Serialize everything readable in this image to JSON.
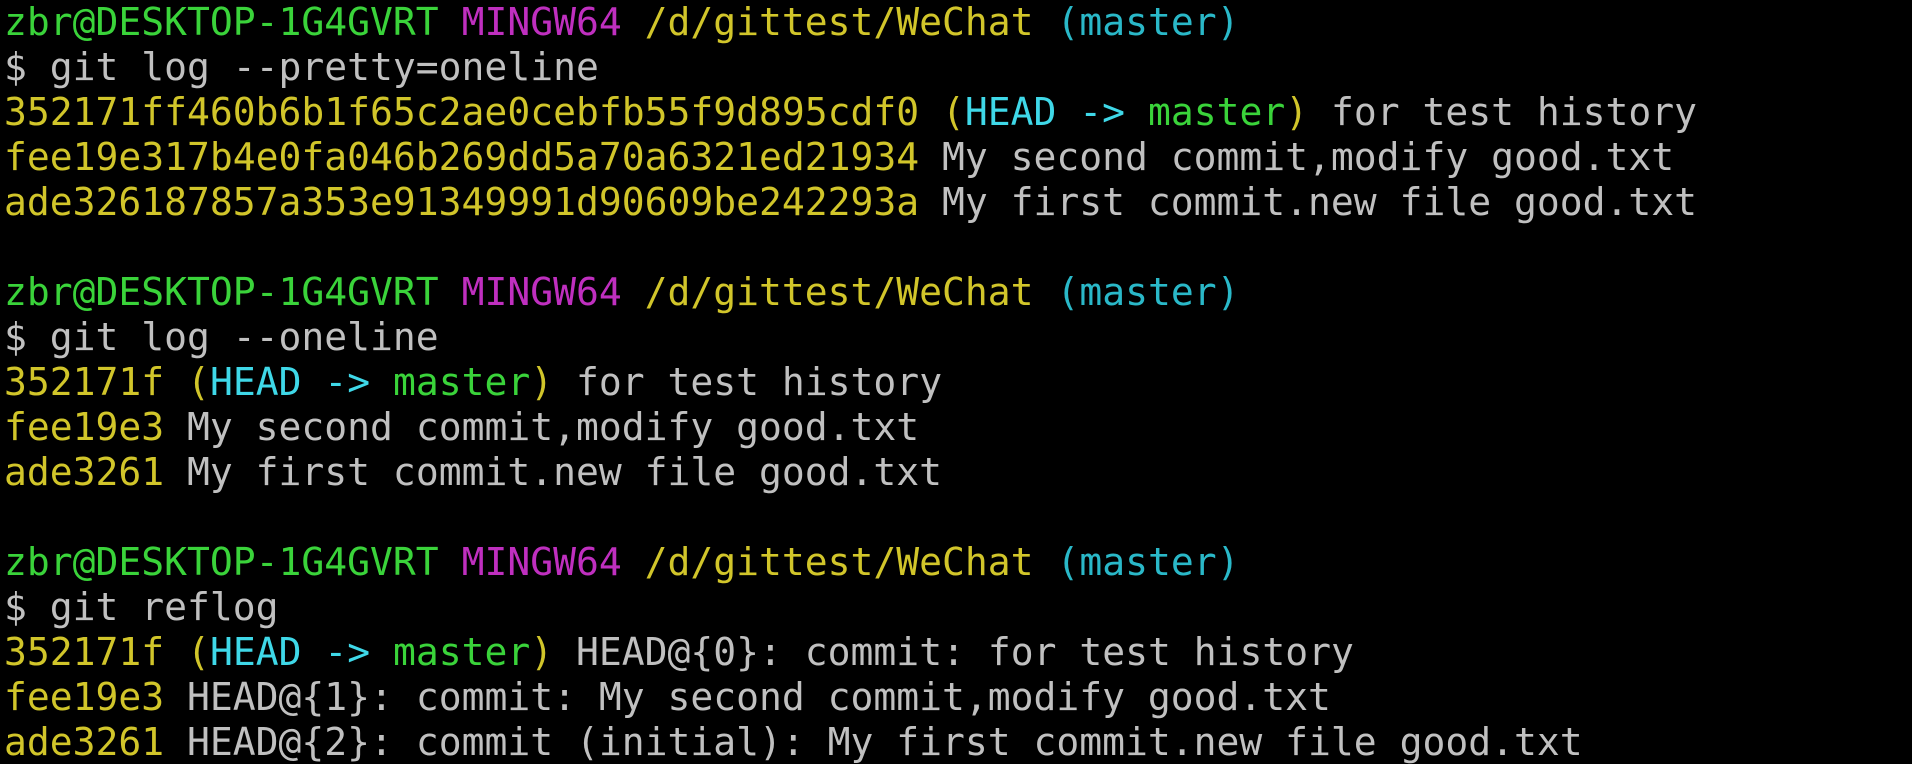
{
  "colors": {
    "background": "#000000",
    "text": "#c0c0c0",
    "prompt_user": "#3ad33a",
    "prompt_system": "#bf2fbf",
    "prompt_path": "#d1c52a",
    "prompt_branch": "#2ab8c8",
    "hash": "#d1c52a",
    "paren": "#d1c52a",
    "head": "#3fd8e8",
    "branch": "#3ad33a"
  },
  "lines": [
    {
      "kind": "prompt",
      "segments": [
        {
          "text": "zbr@DESKTOP-1G4GVRT",
          "color": "prompt_user"
        },
        {
          "text": " ",
          "color": "text"
        },
        {
          "text": "MINGW64",
          "color": "prompt_system"
        },
        {
          "text": " ",
          "color": "text"
        },
        {
          "text": "/d/gittest/WeChat",
          "color": "prompt_path"
        },
        {
          "text": " ",
          "color": "text"
        },
        {
          "text": "(master)",
          "color": "prompt_branch"
        }
      ]
    },
    {
      "kind": "command",
      "segments": [
        {
          "text": "$ git log --pretty=oneline",
          "color": "text"
        }
      ]
    },
    {
      "kind": "output",
      "segments": [
        {
          "text": "352171ff460b6b1f65c2ae0cebfb55f9d895cdf0",
          "color": "hash"
        },
        {
          "text": " ",
          "color": "text"
        },
        {
          "text": "(",
          "color": "paren"
        },
        {
          "text": "HEAD -> ",
          "color": "head"
        },
        {
          "text": "master",
          "color": "branch"
        },
        {
          "text": ")",
          "color": "paren"
        },
        {
          "text": " for test history",
          "color": "text"
        }
      ]
    },
    {
      "kind": "output",
      "segments": [
        {
          "text": "fee19e317b4e0fa046b269dd5a70a6321ed21934",
          "color": "hash"
        },
        {
          "text": " My second commit,modify good.txt",
          "color": "text"
        }
      ]
    },
    {
      "kind": "output",
      "segments": [
        {
          "text": "ade326187857a353e91349991d90609be242293a",
          "color": "hash"
        },
        {
          "text": " My first commit.new file good.txt",
          "color": "text"
        }
      ]
    },
    {
      "kind": "blank",
      "segments": []
    },
    {
      "kind": "prompt",
      "segments": [
        {
          "text": "zbr@DESKTOP-1G4GVRT",
          "color": "prompt_user"
        },
        {
          "text": " ",
          "color": "text"
        },
        {
          "text": "MINGW64",
          "color": "prompt_system"
        },
        {
          "text": " ",
          "color": "text"
        },
        {
          "text": "/d/gittest/WeChat",
          "color": "prompt_path"
        },
        {
          "text": " ",
          "color": "text"
        },
        {
          "text": "(master)",
          "color": "prompt_branch"
        }
      ]
    },
    {
      "kind": "command",
      "segments": [
        {
          "text": "$ git log --oneline",
          "color": "text"
        }
      ]
    },
    {
      "kind": "output",
      "segments": [
        {
          "text": "352171f",
          "color": "hash"
        },
        {
          "text": " ",
          "color": "text"
        },
        {
          "text": "(",
          "color": "paren"
        },
        {
          "text": "HEAD -> ",
          "color": "head"
        },
        {
          "text": "master",
          "color": "branch"
        },
        {
          "text": ")",
          "color": "paren"
        },
        {
          "text": " for test history",
          "color": "text"
        }
      ]
    },
    {
      "kind": "output",
      "segments": [
        {
          "text": "fee19e3",
          "color": "hash"
        },
        {
          "text": " My second commit,modify good.txt",
          "color": "text"
        }
      ]
    },
    {
      "kind": "output",
      "segments": [
        {
          "text": "ade3261",
          "color": "hash"
        },
        {
          "text": " My first commit.new file good.txt",
          "color": "text"
        }
      ]
    },
    {
      "kind": "blank",
      "segments": []
    },
    {
      "kind": "prompt",
      "segments": [
        {
          "text": "zbr@DESKTOP-1G4GVRT",
          "color": "prompt_user"
        },
        {
          "text": " ",
          "color": "text"
        },
        {
          "text": "MINGW64",
          "color": "prompt_system"
        },
        {
          "text": " ",
          "color": "text"
        },
        {
          "text": "/d/gittest/WeChat",
          "color": "prompt_path"
        },
        {
          "text": " ",
          "color": "text"
        },
        {
          "text": "(master)",
          "color": "prompt_branch"
        }
      ]
    },
    {
      "kind": "command",
      "segments": [
        {
          "text": "$ git reflog",
          "color": "text"
        }
      ]
    },
    {
      "kind": "output",
      "segments": [
        {
          "text": "352171f",
          "color": "hash"
        },
        {
          "text": " ",
          "color": "text"
        },
        {
          "text": "(",
          "color": "paren"
        },
        {
          "text": "HEAD -> ",
          "color": "head"
        },
        {
          "text": "master",
          "color": "branch"
        },
        {
          "text": ")",
          "color": "paren"
        },
        {
          "text": " HEAD@{0}: commit: for test history",
          "color": "text"
        }
      ]
    },
    {
      "kind": "output",
      "segments": [
        {
          "text": "fee19e3",
          "color": "hash"
        },
        {
          "text": " HEAD@{1}: commit: My second commit,modify good.txt",
          "color": "text"
        }
      ]
    },
    {
      "kind": "output",
      "segments": [
        {
          "text": "ade3261",
          "color": "hash"
        },
        {
          "text": " HEAD@{2}: commit (initial): My first commit.new file good.txt",
          "color": "text"
        }
      ]
    }
  ]
}
